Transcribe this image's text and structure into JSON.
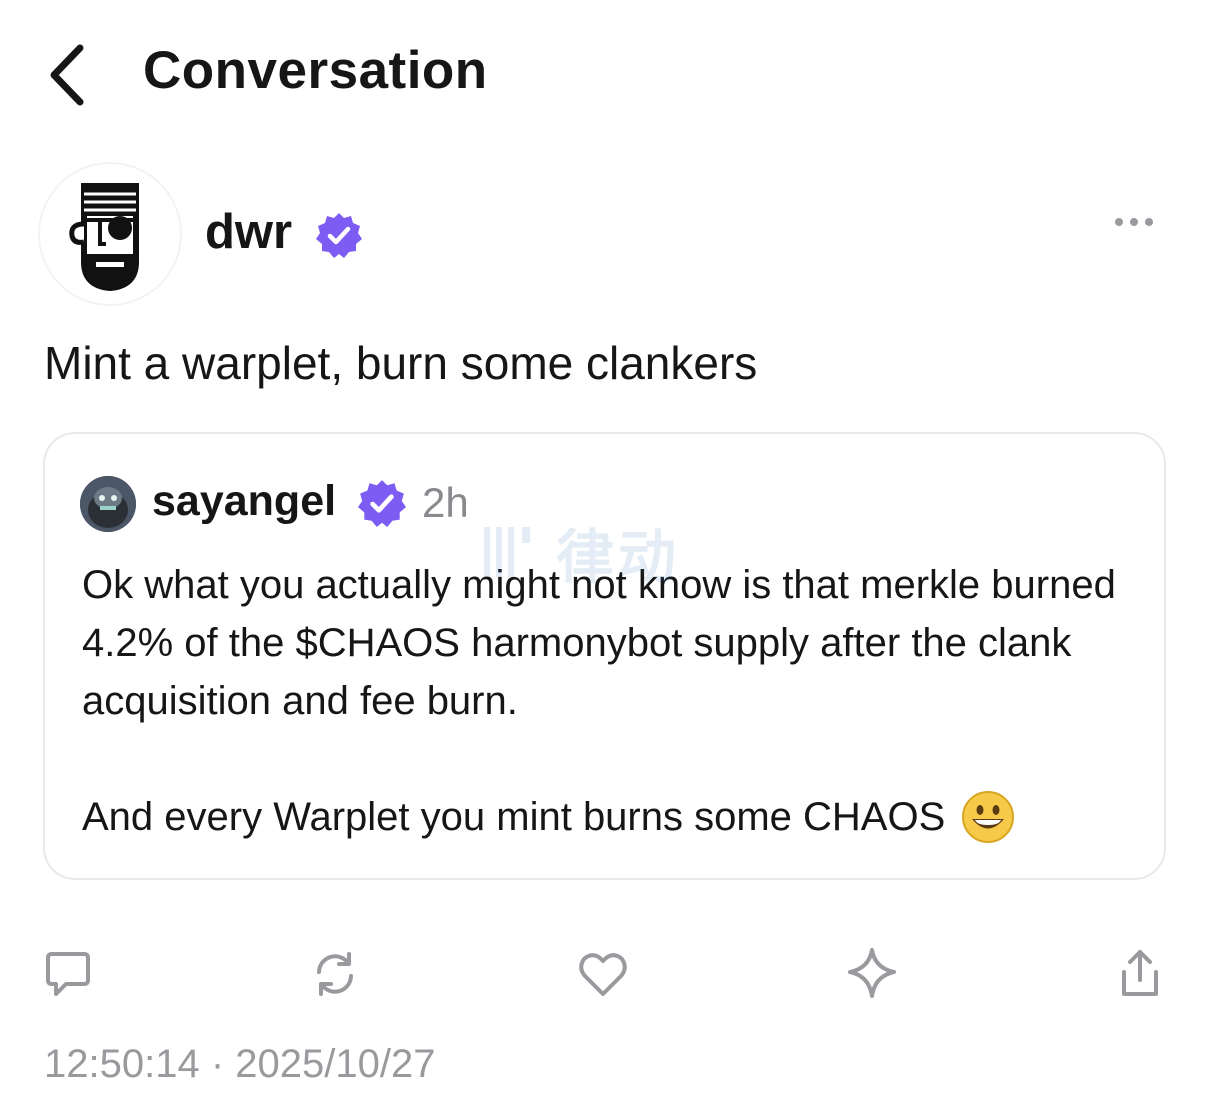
{
  "header": {
    "title": "Conversation",
    "back_icon": "chevron-left-icon"
  },
  "cast": {
    "author": {
      "name": "dwr",
      "verified": true,
      "badge_color": "#7c5cf2"
    },
    "text": "Mint a warplet, burn some clankers",
    "quote": {
      "author": {
        "name": "sayangel",
        "verified": true
      },
      "time": "2h",
      "paragraphs": [
        "Ok what you actually might not know is that merkle burned 4.2% of the $CHAOS harmonybot supply after the clank acquisition and fee burn.",
        "And every Warplet you mint burns some CHAOS"
      ],
      "emoji": "grinning-face-emoji"
    },
    "actions": [
      "reply-icon",
      "recast-icon",
      "like-icon",
      "sparkle-icon",
      "share-icon"
    ],
    "timestamp": "12:50:14 · 2025/10/27"
  },
  "watermark": {
    "text": "律动"
  },
  "colors": {
    "verified": "#7c5cf2",
    "icon_gray": "#9a9a9e",
    "card_border": "#e9e9ea",
    "text": "#161616"
  }
}
